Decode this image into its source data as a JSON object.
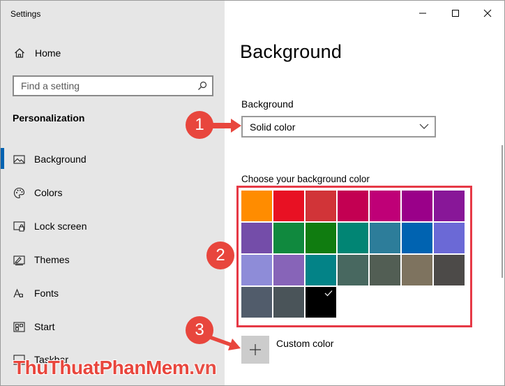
{
  "window": {
    "title": "Settings"
  },
  "sidebar": {
    "home_label": "Home",
    "search_placeholder": "Find a setting",
    "section_title": "Personalization",
    "items": [
      {
        "label": "Background",
        "icon": "picture-icon",
        "active": true
      },
      {
        "label": "Colors",
        "icon": "palette-icon",
        "active": false
      },
      {
        "label": "Lock screen",
        "icon": "lock-screen-icon",
        "active": false
      },
      {
        "label": "Themes",
        "icon": "themes-icon",
        "active": false
      },
      {
        "label": "Fonts",
        "icon": "fonts-icon",
        "active": false
      },
      {
        "label": "Start",
        "icon": "start-icon",
        "active": false
      },
      {
        "label": "Taskbar",
        "icon": "taskbar-icon",
        "active": false
      }
    ]
  },
  "main": {
    "page_title": "Background",
    "background_label": "Background",
    "background_value": "Solid color",
    "choose_label": "Choose your background color",
    "custom_color_label": "Custom color",
    "selected_swatch_index": 23,
    "palette": [
      "#ff8c00",
      "#e81123",
      "#d13438",
      "#c30052",
      "#bf0077",
      "#9a0089",
      "#881798",
      "#744da9",
      "#10893e",
      "#107c10",
      "#018574",
      "#2d7d9a",
      "#0063b1",
      "#6b69d6",
      "#8e8cd8",
      "#8764b8",
      "#038387",
      "#486860",
      "#525e54",
      "#7e735f",
      "#4c4a48",
      "#515c6b",
      "#4a5459",
      "#000000"
    ]
  },
  "callouts": [
    "1",
    "2",
    "3"
  ],
  "watermark": {
    "part1": "ThuThuat",
    "part2": "PhanMem",
    "part3": ".vn"
  },
  "colors": {
    "accent": "#0063b1",
    "callout": "#e8463d",
    "sidebar_bg": "#e6e6e6"
  }
}
